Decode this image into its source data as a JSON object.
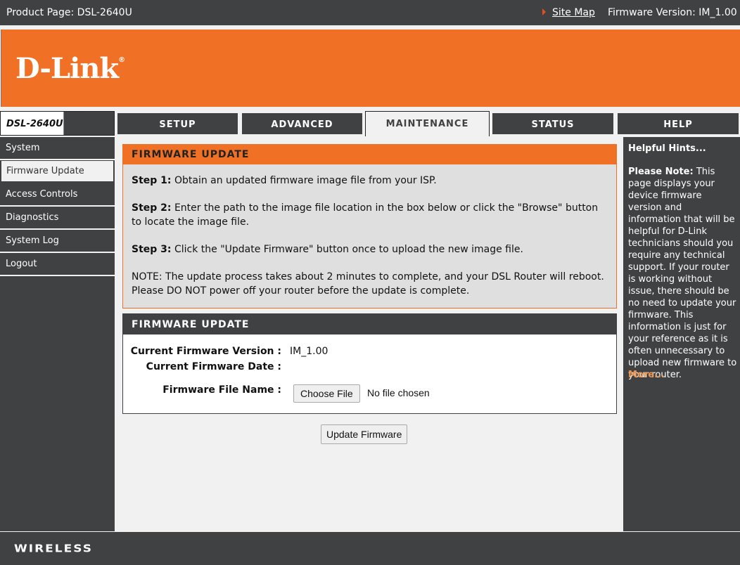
{
  "topbar": {
    "product_page": "Product Page: DSL-2640U",
    "site_map": "Site Map",
    "firmware_version": "Firmware Version: IM_1.00"
  },
  "brand": {
    "logo": "D-Link",
    "registered": "®",
    "model": "DSL-2640U",
    "accent_color": "#f07125",
    "dark_color": "#404142"
  },
  "tabs": [
    {
      "label": "SETUP",
      "active": false
    },
    {
      "label": "ADVANCED",
      "active": false
    },
    {
      "label": "MAINTENANCE",
      "active": true
    },
    {
      "label": "STATUS",
      "active": false
    },
    {
      "label": "HELP",
      "active": false
    }
  ],
  "sidebar": {
    "items": [
      {
        "label": "System",
        "active": false
      },
      {
        "label": "Firmware Update",
        "active": true
      },
      {
        "label": "Access Controls",
        "active": false
      },
      {
        "label": "Diagnostics",
        "active": false
      },
      {
        "label": "System Log",
        "active": false
      },
      {
        "label": "Logout",
        "active": false
      }
    ]
  },
  "intro": {
    "title": "FIRMWARE UPDATE",
    "step1_label": "Step 1:",
    "step1_text": " Obtain an updated firmware image file from your ISP.",
    "step2_label": "Step 2:",
    "step2_text": " Enter the path to the image file location in the box below or click the \"Browse\" button to locate the image file.",
    "step3_label": "Step 3:",
    "step3_text": " Click the \"Update Firmware\" button once to upload the new image file.",
    "note": "NOTE: The update process takes about 2 minutes to complete, and your DSL Router will reboot. Please DO NOT power off your router before the update is complete."
  },
  "form": {
    "title": "FIRMWARE UPDATE",
    "version_label": "Current Firmware Version :",
    "version_value": "IM_1.00",
    "date_label": "Current Firmware Date :",
    "date_value": "",
    "file_label": "Firmware File Name :",
    "choose_file": "Choose File",
    "no_file": "No file chosen",
    "update_button": "Update Firmware"
  },
  "hints": {
    "title": "Helpful Hints...",
    "note_label": "Please Note:",
    "note_text": " This page displays your device firmware version and information that will be helpful for D-Link technicians should you require any technical support. If your router is working without issue, there should be no need to update your firmware. This information is just for your reference as it is often unnecessary to upload new firmware to your router.",
    "more": "More..."
  },
  "footer": {
    "label": "WIRELESS"
  }
}
